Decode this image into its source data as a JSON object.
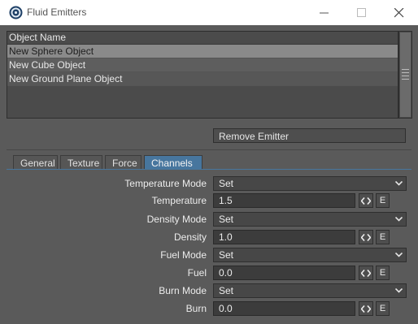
{
  "window": {
    "title": "Fluid Emitters",
    "minimize_icon": "minimize-icon",
    "maximize_icon": "maximize-icon",
    "close_icon": "close-icon"
  },
  "object_list": {
    "header": "Object Name",
    "items": [
      {
        "label": "New Sphere Object",
        "selected": true
      },
      {
        "label": "New Cube Object",
        "selected": false
      },
      {
        "label": "New Ground Plane Object",
        "selected": false
      }
    ]
  },
  "buttons": {
    "remove_emitter": "Remove Emitter"
  },
  "tabs": [
    {
      "label": "General",
      "active": false
    },
    {
      "label": "Texture",
      "active": false
    },
    {
      "label": "Force",
      "active": false
    },
    {
      "label": "Channels",
      "active": true
    }
  ],
  "channels": {
    "temperature_mode": {
      "label": "Temperature Mode",
      "value": "Set"
    },
    "temperature": {
      "label": "Temperature",
      "value": "1.5"
    },
    "density_mode": {
      "label": "Density Mode",
      "value": "Set"
    },
    "density": {
      "label": "Density",
      "value": "1.0"
    },
    "fuel_mode": {
      "label": "Fuel Mode",
      "value": "Set"
    },
    "fuel": {
      "label": "Fuel",
      "value": "0.0"
    },
    "burn_mode": {
      "label": "Burn Mode",
      "value": "Set"
    },
    "burn": {
      "label": "Burn",
      "value": "0.0"
    },
    "envelope_button_label": "E"
  },
  "colors": {
    "panel_bg": "#5a5a5a",
    "active_tab": "#47769e",
    "selected_row": "#8a8a8a"
  }
}
